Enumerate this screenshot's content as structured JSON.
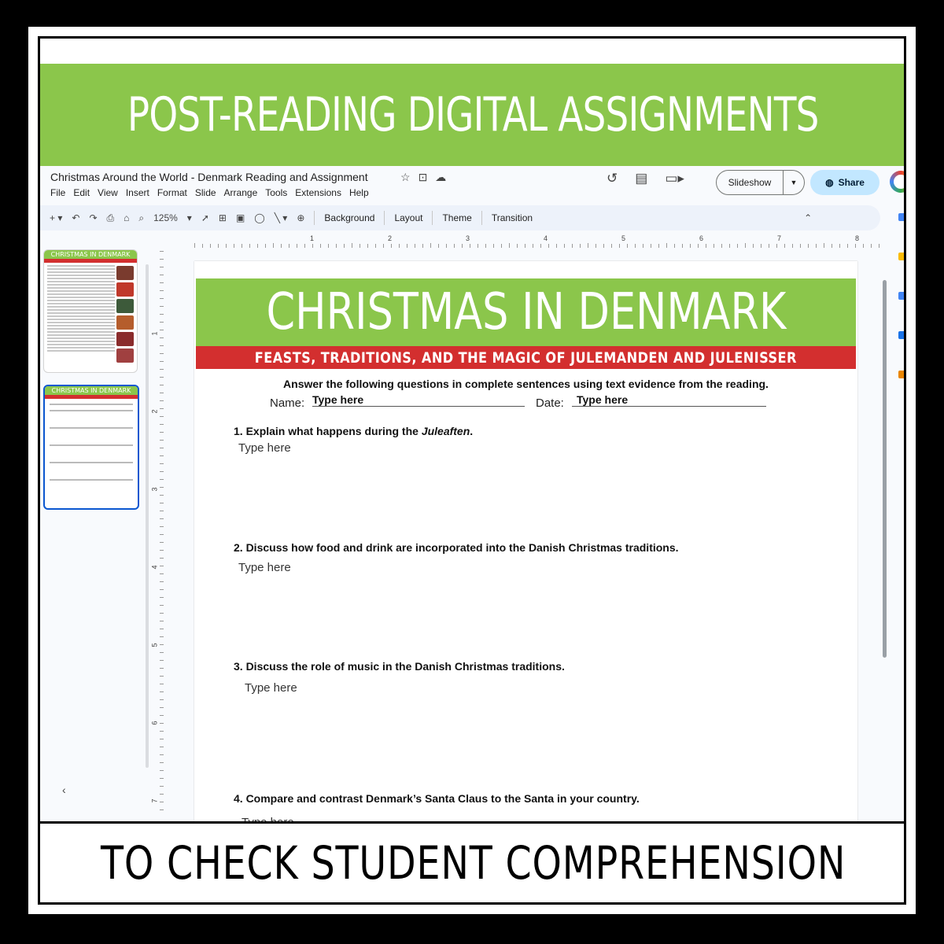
{
  "promo": {
    "top_title": "POST-READING DIGITAL ASSIGNMENTS",
    "bottom_title": "TO CHECK STUDENT COMPREHENSION"
  },
  "app": {
    "doc_title": "Christmas Around the World - Denmark Reading and Assignment",
    "menu": [
      "File",
      "Edit",
      "View",
      "Insert",
      "Format",
      "Slide",
      "Arrange",
      "Tools",
      "Extensions",
      "Help"
    ],
    "slideshow_label": "Slideshow",
    "share_label": "Share",
    "zoom": "125%",
    "toolbar_text": {
      "background": "Background",
      "layout": "Layout",
      "theme": "Theme",
      "transition": "Transition"
    },
    "ruler_h": [
      "1",
      "2",
      "3",
      "4",
      "5",
      "6",
      "7",
      "8"
    ],
    "ruler_v": [
      "1",
      "2",
      "3",
      "4",
      "5",
      "6",
      "7"
    ],
    "thumb_title": "CHRISTMAS IN DENMARK",
    "colors": {
      "green": "#8bc64b",
      "red": "#d32f2f",
      "select_blue": "#0b57d0",
      "share_bg": "#c2e7ff"
    },
    "icons": [
      "star-icon",
      "move-folder-icon",
      "cloud-status-icon",
      "history-icon",
      "comment-icon",
      "meet-icon",
      "globe-icon",
      "chevron-up-icon",
      "collapse-left-icon"
    ]
  },
  "slide": {
    "title": "CHRISTMAS IN DENMARK",
    "subtitle": "FEASTS, TRADITIONS, AND THE MAGIC OF JULEMANDEN AND JULENISSER",
    "instructions": "Answer the following questions in complete sentences using text evidence from the reading.",
    "name_label": "Name:",
    "name_value": "Type here",
    "date_label": "Date:",
    "date_value": "Type here",
    "q1_prefix": "1. Explain what happens during the ",
    "q1_em": "Juleaften",
    "q1_suffix": ".",
    "q2": "2. Discuss how food and drink are incorporated into the Danish Christmas traditions.",
    "q3": "3. Discuss the role of music in the Danish Christmas traditions.",
    "q4": "4. Compare and contrast Denmark’s Santa Claus to the Santa in your country.",
    "answer_placeholder": "Type here"
  }
}
